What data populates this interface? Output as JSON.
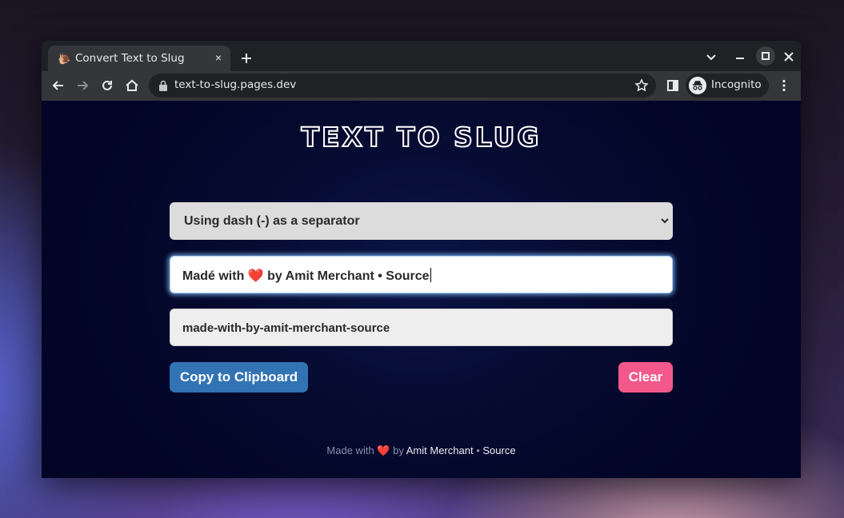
{
  "browser": {
    "tab": {
      "favicon": "snail-icon",
      "title": "Convert Text to Slug",
      "close": "×"
    },
    "url": "text-to-slug.pages.dev",
    "profile_label": "Incognito"
  },
  "app": {
    "title": "Text to Slug",
    "separator_select": {
      "selected": "Using dash (-) as a separator"
    },
    "input": {
      "value": "Madé with ❤️ by Amit Merchant • Source"
    },
    "output": {
      "value": "made-with-by-amit-merchant-source"
    },
    "buttons": {
      "copy": "Copy to Clipboard",
      "clear": "Clear"
    },
    "footer": {
      "made_with": "Made with",
      "heart": "❤️",
      "by": "by",
      "author": "Amit Merchant",
      "separator": "•",
      "source": "Source"
    }
  },
  "colors": {
    "page_bg": "#050a2f",
    "copy_button": "#3273b4",
    "clear_button": "#f2588a"
  }
}
